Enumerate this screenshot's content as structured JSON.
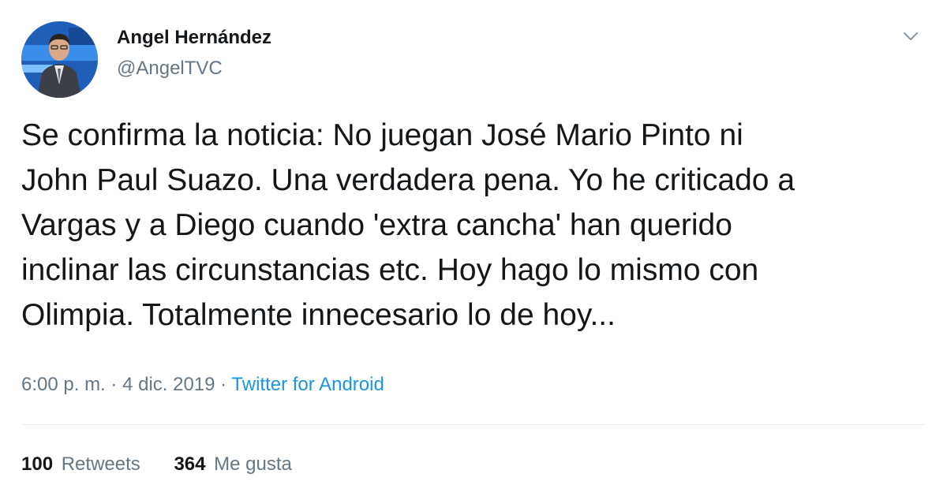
{
  "user": {
    "display_name": "Angel Hernández",
    "handle": "@AngelTVC"
  },
  "tweet": {
    "text": "Se confirma la noticia: No juegan José Mario Pinto ni\nJohn Paul Suazo. Una verdadera pena. Yo he criticado a\nVargas y a Diego cuando 'extra cancha' han querido\ninclinar las circunstancias etc. Hoy hago lo mismo con\nOlimpia. Totalmente innecesario lo de hoy...",
    "time": "6:00 p. m.",
    "separator": "·",
    "date": "4 dic. 2019",
    "source": "Twitter for Android"
  },
  "stats": {
    "retweets_count": "100",
    "retweets_label": "Retweets",
    "likes_count": "364",
    "likes_label": "Me gusta"
  },
  "icons": {
    "menu": "chevron-down-icon"
  },
  "colors": {
    "text": "#14171a",
    "secondary": "#657786",
    "link": "#1b95e0",
    "divider": "#e6ecf0"
  }
}
